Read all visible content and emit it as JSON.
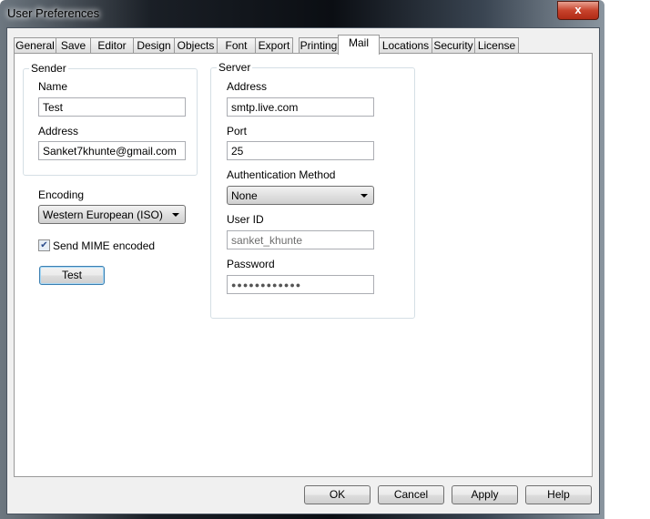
{
  "window": {
    "title": "User Preferences",
    "close": "x"
  },
  "tabs": [
    "General",
    "Save",
    "Editor",
    "Design",
    "Objects",
    "Font",
    "Export",
    "Printing",
    "Mail",
    "Locations",
    "Security",
    "License"
  ],
  "selected_tab": "Mail",
  "sender": {
    "legend": "Sender",
    "name_label": "Name",
    "name_value": "Test",
    "address_label": "Address",
    "address_value": "Sanket7khunte@gmail.com"
  },
  "encoding": {
    "label": "Encoding",
    "value": "Western European (ISO)"
  },
  "mime": {
    "label": "Send MIME encoded",
    "checked": true
  },
  "test_button": "Test",
  "server": {
    "legend": "Server",
    "address_label": "Address",
    "address_value": "smtp.live.com",
    "port_label": "Port",
    "port_value": "25",
    "auth_label": "Authentication Method",
    "auth_value": "None",
    "userid_label": "User ID",
    "userid_value": "sanket_khunte",
    "password_label": "Password",
    "password_value": "●●●●●●●●●●●●"
  },
  "buttons": {
    "ok": "OK",
    "cancel": "Cancel",
    "apply": "Apply",
    "help": "Help"
  }
}
